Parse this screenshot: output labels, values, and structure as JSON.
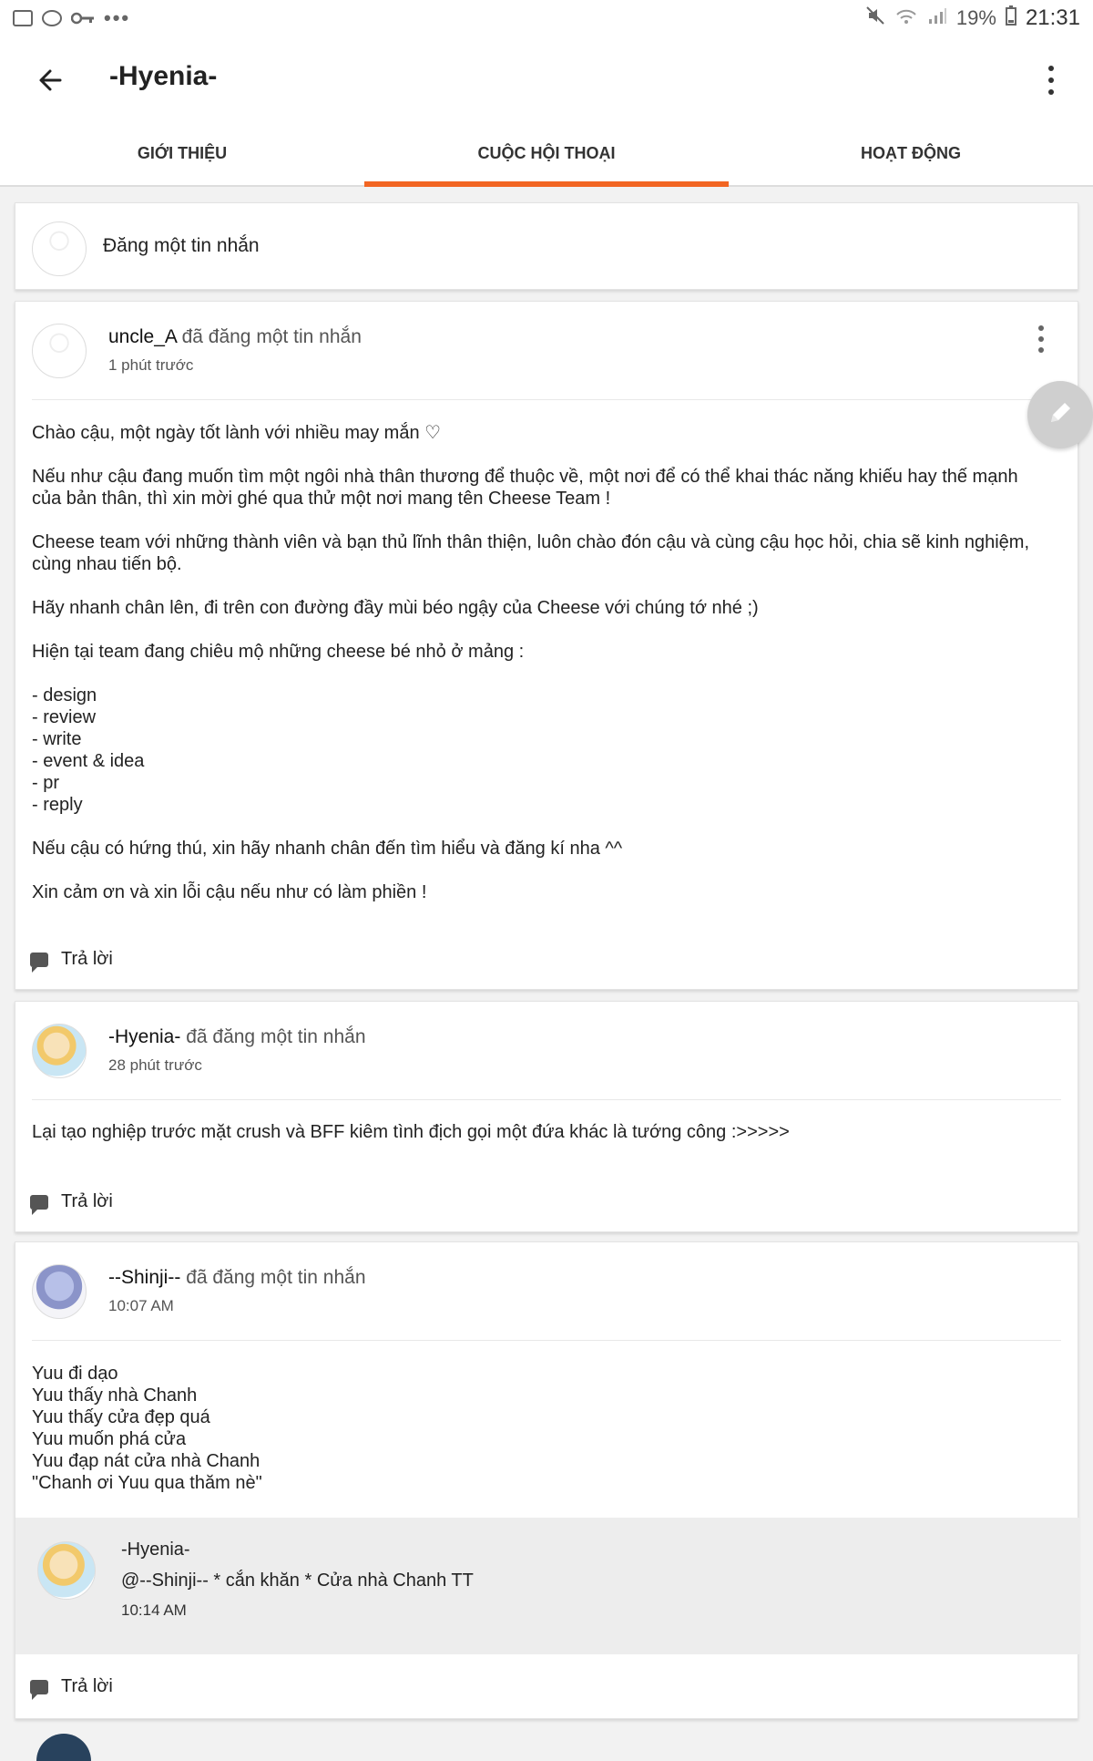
{
  "statusbar": {
    "battery": "19%",
    "time": "21:31",
    "dots": "•••",
    "left_icons": [
      "image-icon",
      "media-icon",
      "key-icon"
    ],
    "right_icons": [
      "mute-icon",
      "wifi-icon",
      "signal-icon",
      "battery-icon"
    ]
  },
  "appbar": {
    "title": "-Hyenia-",
    "back_icon": "arrow-left-icon",
    "menu_icon": "more-vertical-icon"
  },
  "tabs": [
    {
      "label": "GIỚI THIỆU",
      "active": false
    },
    {
      "label": "CUỘC HỘI THOẠI",
      "active": true
    },
    {
      "label": "HOẠT ĐỘNG",
      "active": false
    }
  ],
  "colors": {
    "accent": "#f26522",
    "background": "#f2f2f2"
  },
  "compose": {
    "label": "Đăng một tin nhắn"
  },
  "posts": [
    {
      "author": "uncle_A",
      "action": "đã đăng một tin nhắn",
      "time": "1 phút trước",
      "body": "Chào cậu, một ngày tốt lành với nhiều may mắn ♡\n\nNếu như cậu đang muốn tìm một ngôi nhà thân thương để thuộc về, một nơi để có thể khai thác năng khiếu hay thế mạnh của bản thân, thì xin mời ghé qua thử một nơi mang tên Cheese Team !\n\nCheese team với những thành viên và bạn thủ lĩnh thân thiện, luôn chào đón cậu và cùng cậu học hỏi, chia sẽ kinh nghiệm, cùng nhau tiến bộ.\n\nHãy nhanh chân lên, đi trên con đường đầy mùi béo ngậy của Cheese với chúng tớ nhé ;)\n\nHiện tại team đang chiêu mộ những cheese bé nhỏ ở mảng :\n\n- design\n- review\n- write\n- event & idea\n- pr\n- reply\n\nNếu cậu có hứng thú, xin hãy nhanh chân đến tìm hiểu và đăng kí nha ^^\n\nXin cảm ơn và xin lỗi cậu nếu như có làm phiền !",
      "reply_label": "Trả lời"
    },
    {
      "author": "-Hyenia-",
      "action": "đã đăng một tin nhắn",
      "time": "28 phút trước",
      "body": "Lại tạo nghiệp trước mặt crush và BFF kiêm tình địch gọi một đứa khác là tướng công :>>>>>",
      "reply_label": "Trả lời"
    },
    {
      "author": "--Shinji--",
      "action": "đã đăng một tin nhắn",
      "time": "10:07 AM",
      "body": "Yuu đi dạo\nYuu thấy nhà Chanh\nYuu thấy cửa đẹp quá\nYuu muốn phá cửa\nYuu đạp nát cửa nhà Chanh\n\"Chanh ơi Yuu qua thăm nè\"",
      "reply": {
        "author": "-Hyenia-",
        "text": "@--Shinji-- * cắn khăn * Cửa nhà Chanh TT",
        "time": "10:14 AM"
      },
      "reply_label": "Trả lời"
    }
  ],
  "fab_icon": "pencil-icon"
}
